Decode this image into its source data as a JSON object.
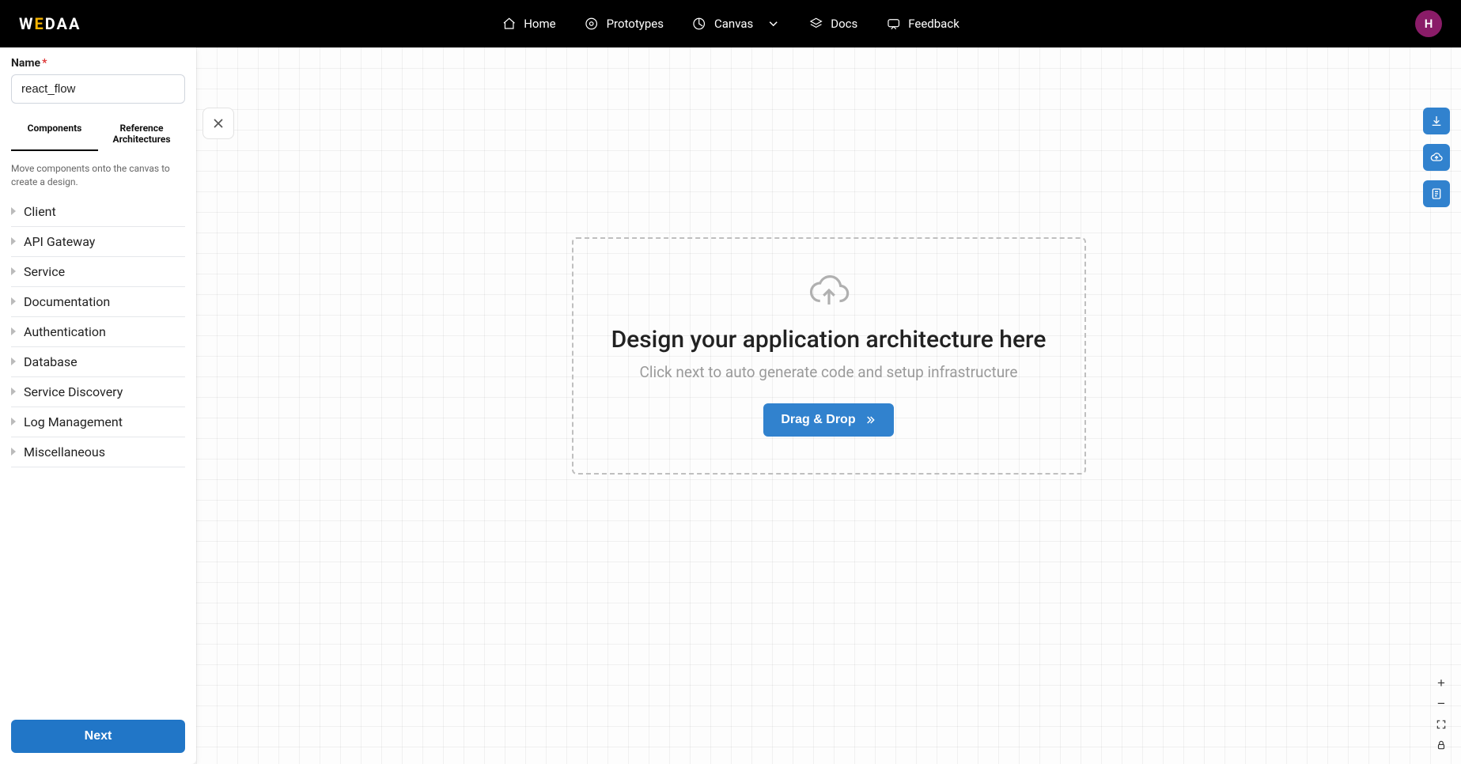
{
  "brand": {
    "name_pre": "W",
    "name_accent": "E",
    "name_post": "DAA"
  },
  "nav": {
    "home": "Home",
    "prototypes": "Prototypes",
    "canvas": "Canvas",
    "docs": "Docs",
    "feedback": "Feedback"
  },
  "user": {
    "initial": "H"
  },
  "sidebar": {
    "name_label": "Name",
    "name_value": "react_flow",
    "tabs": {
      "components": "Components",
      "reference": "Reference Architectures"
    },
    "hint": "Move components onto the canvas to create a design.",
    "categories": [
      "Client",
      "API Gateway",
      "Service",
      "Documentation",
      "Authentication",
      "Database",
      "Service Discovery",
      "Log Management",
      "Miscellaneous"
    ],
    "next_label": "Next"
  },
  "canvas": {
    "title": "Design your application architecture here",
    "subtitle": "Click next to auto generate code and setup infrastructure",
    "drag_label": "Drag & Drop"
  },
  "icons": {
    "download": "download-icon",
    "cloud_up": "cloud-upload-icon",
    "json": "json-icon"
  }
}
